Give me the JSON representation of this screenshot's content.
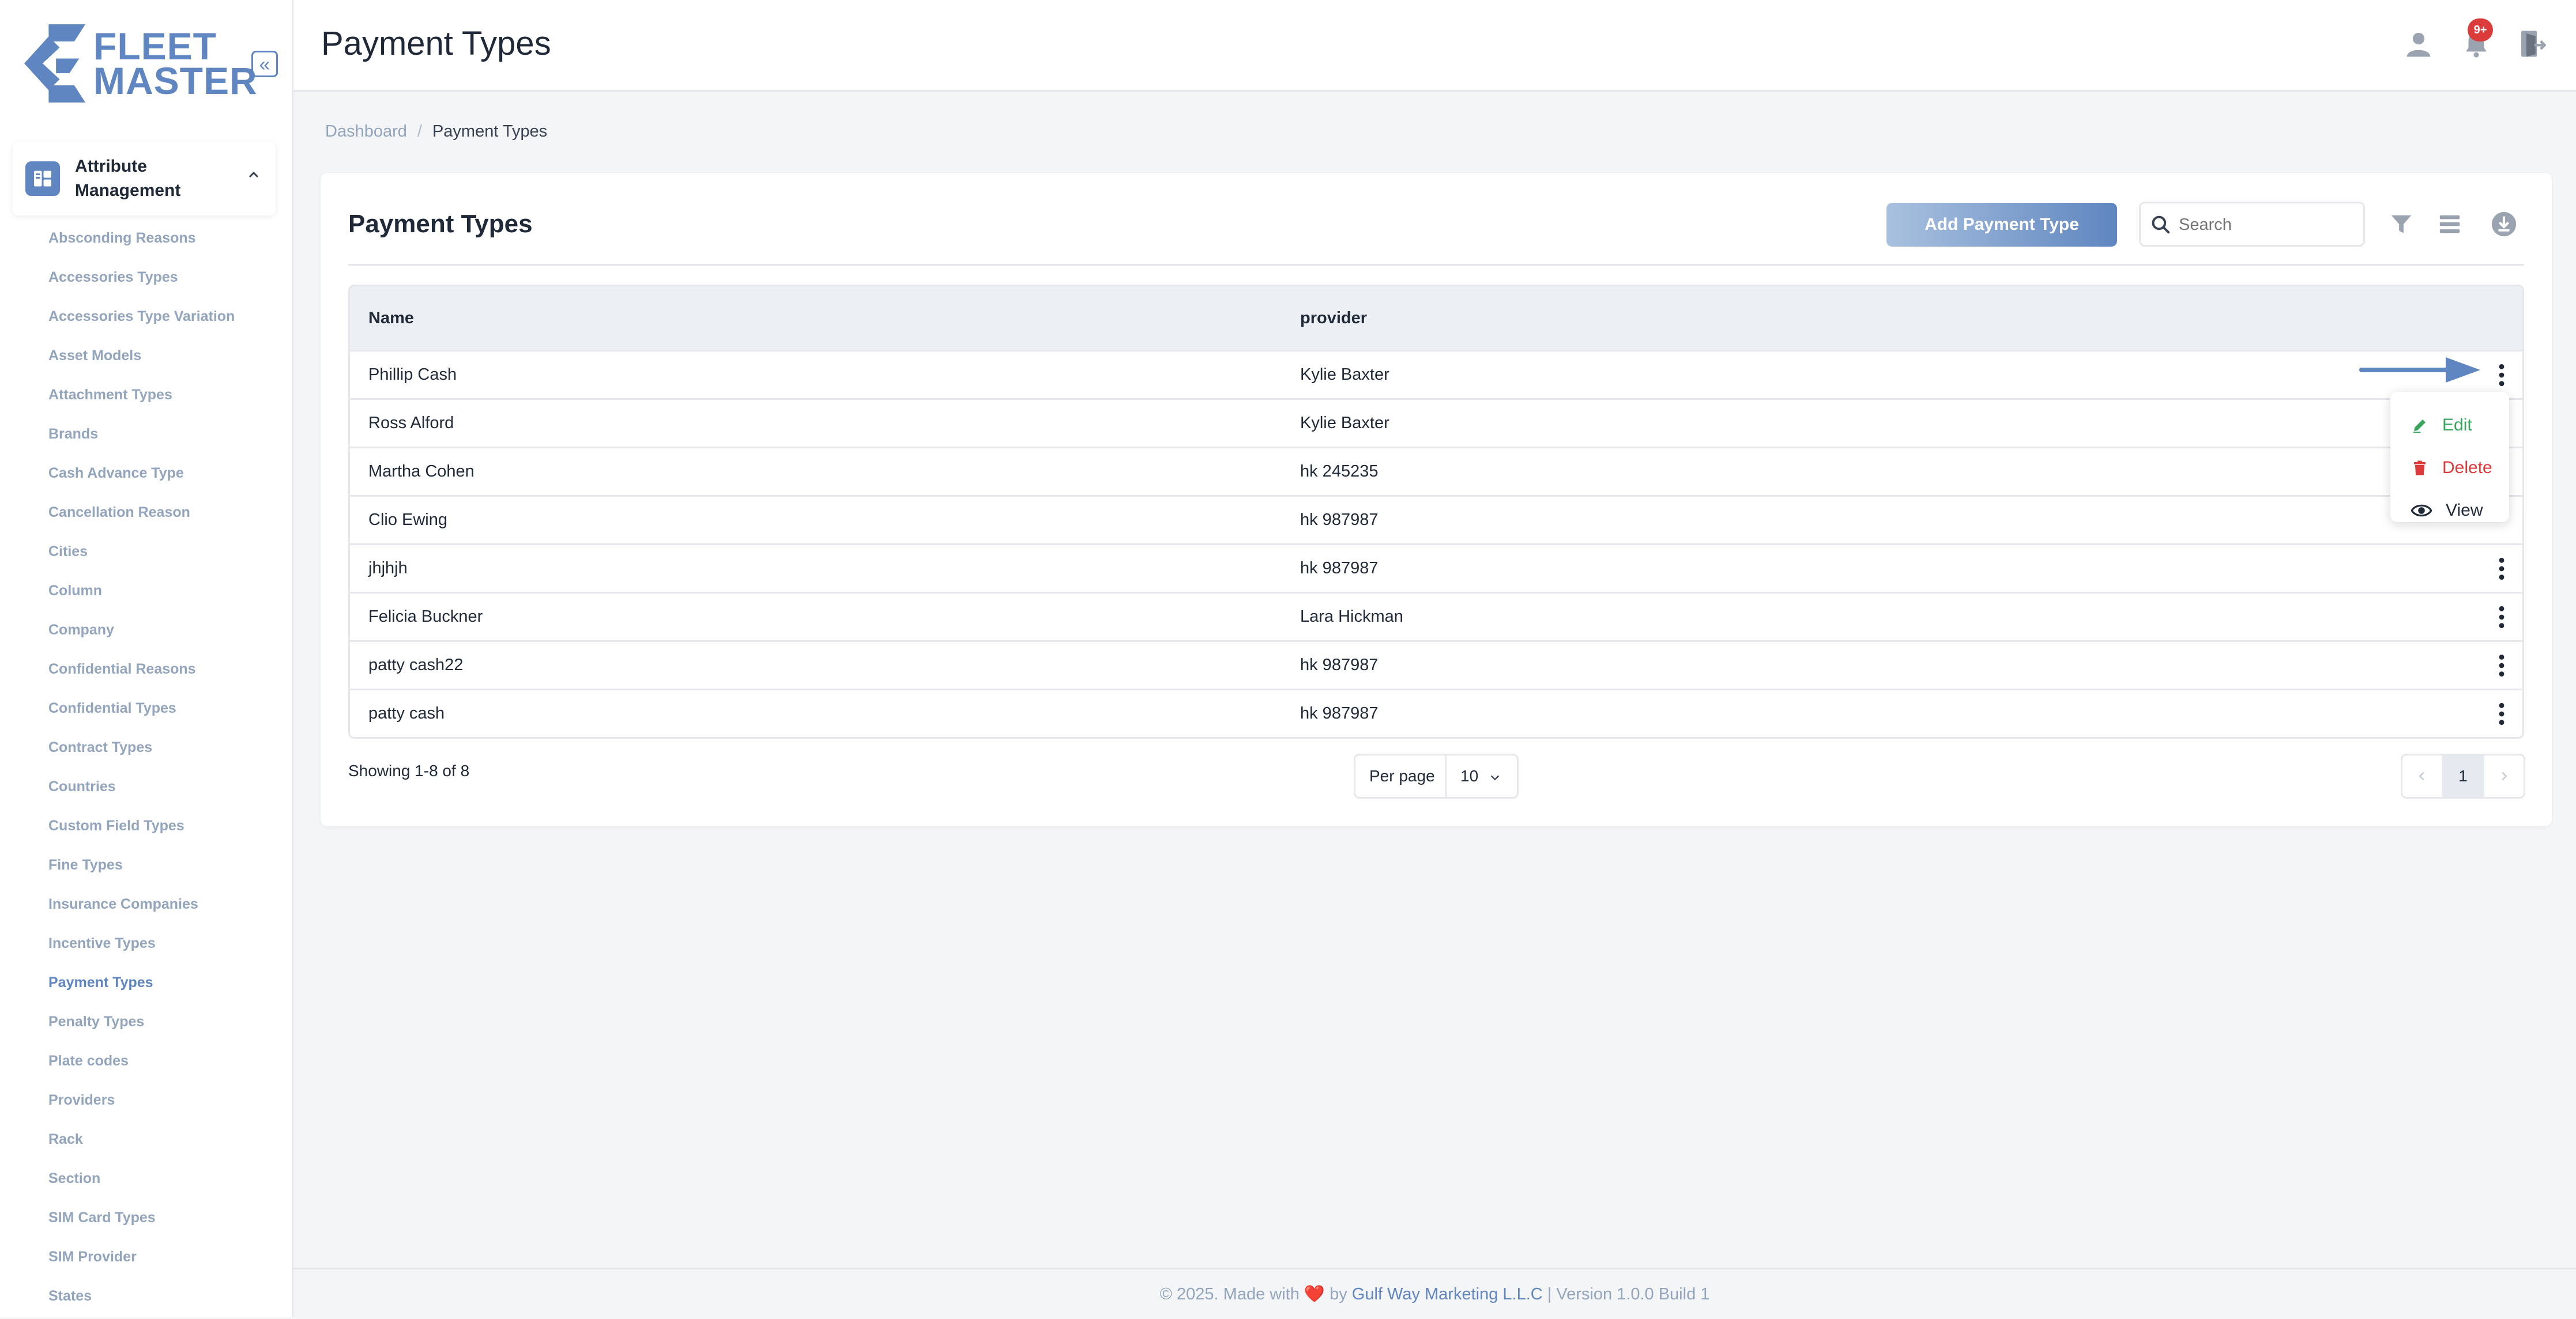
{
  "app": {
    "logo_line1": "FLEET",
    "logo_line2": "MASTER",
    "brand_color": "#5f86c0"
  },
  "sidebar": {
    "collapse_icon": "double-chevron-left-icon",
    "group": {
      "label": "Attribute Management",
      "icon": "attribute-management-icon",
      "expanded": true
    },
    "items": [
      "Absconding Reasons",
      "Accessories Types",
      "Accessories Type Variation",
      "Asset Models",
      "Attachment Types",
      "Brands",
      "Cash Advance Type",
      "Cancellation Reason",
      "Cities",
      "Column",
      "Company",
      "Confidential Reasons",
      "Confidential Types",
      "Contract Types",
      "Countries",
      "Custom Field Types",
      "Fine Types",
      "Insurance Companies",
      "Incentive Types",
      "Payment Types",
      "Penalty Types",
      "Plate codes",
      "Providers",
      "Rack",
      "Section",
      "SIM Card Types",
      "SIM Provider",
      "States"
    ],
    "active_item": "Payment Types"
  },
  "header": {
    "title": "Payment Types",
    "notification_badge": "9+",
    "icons": [
      "user-icon",
      "bell-icon",
      "logout-icon"
    ]
  },
  "breadcrumb": {
    "home": "Dashboard",
    "separator": "/",
    "current": "Payment Types"
  },
  "card": {
    "title": "Payment Types",
    "add_button": "Add Payment Type",
    "search_placeholder": "Search",
    "tool_icons": [
      "filter-icon",
      "columns-icon",
      "download-icon"
    ]
  },
  "table": {
    "columns": [
      "Name",
      "provider"
    ],
    "rows": [
      {
        "name": "Phillip Cash",
        "provider": "Kylie Baxter"
      },
      {
        "name": "Ross Alford",
        "provider": "Kylie Baxter"
      },
      {
        "name": "Martha Cohen",
        "provider": "hk 245235"
      },
      {
        "name": "Clio Ewing",
        "provider": "hk 987987"
      },
      {
        "name": "jhjhjh",
        "provider": "hk 987987"
      },
      {
        "name": "Felicia Buckner",
        "provider": "Lara Hickman"
      },
      {
        "name": "patty cash22",
        "provider": "hk 987987"
      },
      {
        "name": "patty cash",
        "provider": "hk 987987"
      }
    ]
  },
  "row_menu": {
    "edit": "Edit",
    "delete": "Delete",
    "view": "View",
    "edit_color": "#3aa55d",
    "delete_color": "#dc3b3b"
  },
  "pagination": {
    "showing": "Showing 1-8 of 8",
    "per_page_label": "Per page",
    "per_page_value": "10",
    "current_page": "1"
  },
  "footer": {
    "prefix": "© 2025. Made with",
    "heart": "❤️",
    "by": "by",
    "company": "Gulf Way Marketing L.L.C",
    "version": "| Version 1.0.0 Build 1"
  }
}
